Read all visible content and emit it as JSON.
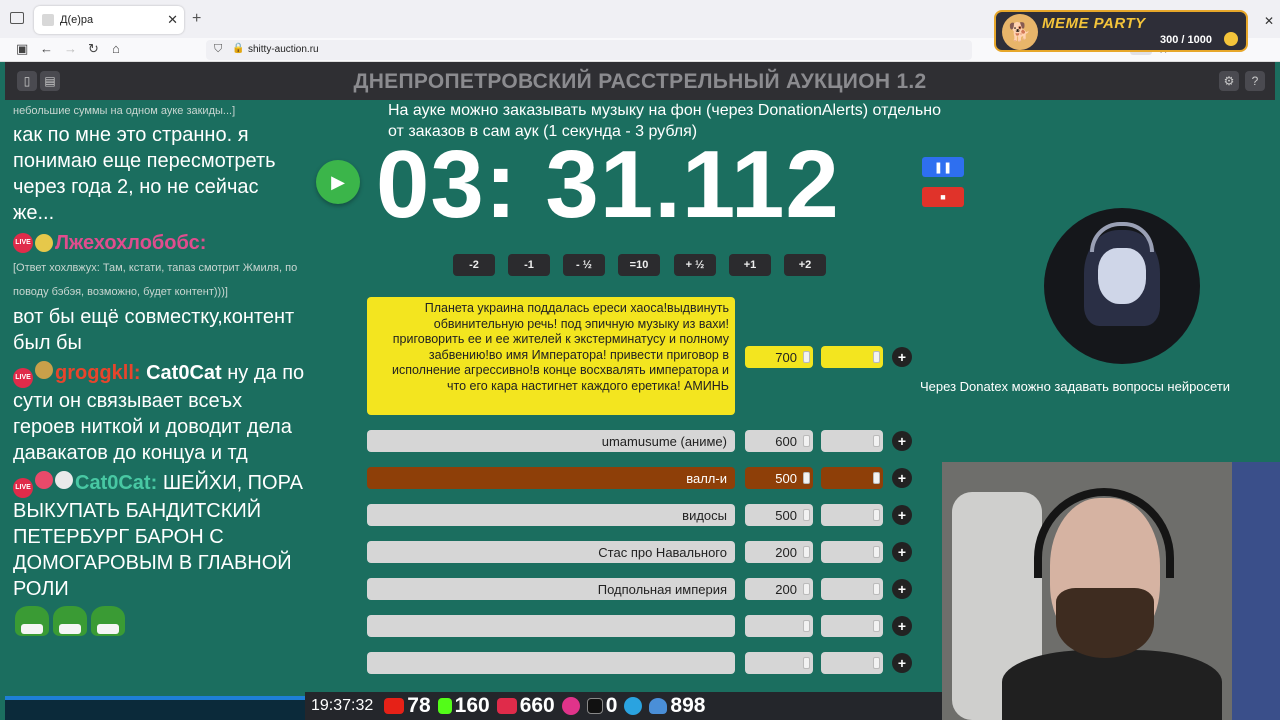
{
  "browser": {
    "tab_title": "Д(е)ра",
    "url": "shitty-auction.ru",
    "zoom": "80%"
  },
  "overlay": {
    "meme_title": "MEME PARTY",
    "meme_count": "300 / 1000"
  },
  "app": {
    "title": "ДНЕПРОПЕТРОВСКИЙ РАССТРЕЛЬНЫЙ АУКЦИОН 1.2"
  },
  "info_text": "На ауке можно заказывать музыку на фон (через DonationAlerts) отдельно от заказов в сам аук (1 секунда - 3 рубля)",
  "timer": "03: 31.112",
  "time_buttons": [
    "-2",
    "-1",
    "- ½",
    "=10",
    "+ ½",
    "+1",
    "+2"
  ],
  "donatex_text": "Через Donatex можно задавать вопросы нейросети",
  "lots": [
    {
      "name": "Планета украина поддалась ереси хаоса!выдвинуть обвинительную речь! под эпичную музыку из вахи! приговорить ее и ее жителей к экстерминатусу и полному забвению!во имя Императора! привести приговор в исполнение агрессивно!в конце восхвалять императора и что его кара настигнет каждого еретика! АМИНЬ",
      "sum": "700"
    },
    {
      "name": "umamusume (аниме)",
      "sum": "600"
    },
    {
      "name": "валл-и",
      "sum": "500"
    },
    {
      "name": "видосы",
      "sum": "500"
    },
    {
      "name": "Стас про Навального",
      "sum": "200"
    },
    {
      "name": "Подпольная империя",
      "sum": "200"
    },
    {
      "name": "",
      "sum": ""
    },
    {
      "name": "",
      "sum": ""
    }
  ],
  "chat": {
    "m0": "небольшие суммы на одном ауке закиды...]",
    "m1": "как по мне это странно. я понимаю еще пересмотреть через года 2, но не сейчас же...",
    "nick1": "Лжехохлобобс:",
    "reply1": "[Ответ хохлвжух: Там, кстати, тапаз смотрит Жмиля, по поводу бэбэя, возможно, будет контент)))]",
    "m2": "вот бы ещё совместку,контент был бы",
    "nick2": "groggkll:",
    "m3_mention": "Cat0Cat",
    "m3": "ну да по сути он связывает всеъх героев ниткой и доводит дела давакатов до концуа и тд",
    "nick3": "Cat0Cat:",
    "m4": "ШЕЙХИ, ПОРА ВЫКУПАТЬ БАНДИТСКИЙ ПЕТЕРБУРГ БАРОН С ДОМОГАРОВЫМ В ГЛАВНОЙ РОЛИ",
    "live": "LIVE"
  },
  "status": {
    "clock": "19:37:32",
    "youtube": "78",
    "kick": "160",
    "vk": "660",
    "rutube": "0",
    "telegram": "898"
  },
  "colors": {
    "background": "#1b6e5f",
    "header": "#2f2f33",
    "highlight": "#f3e51f",
    "brown": "#8e3f08"
  }
}
